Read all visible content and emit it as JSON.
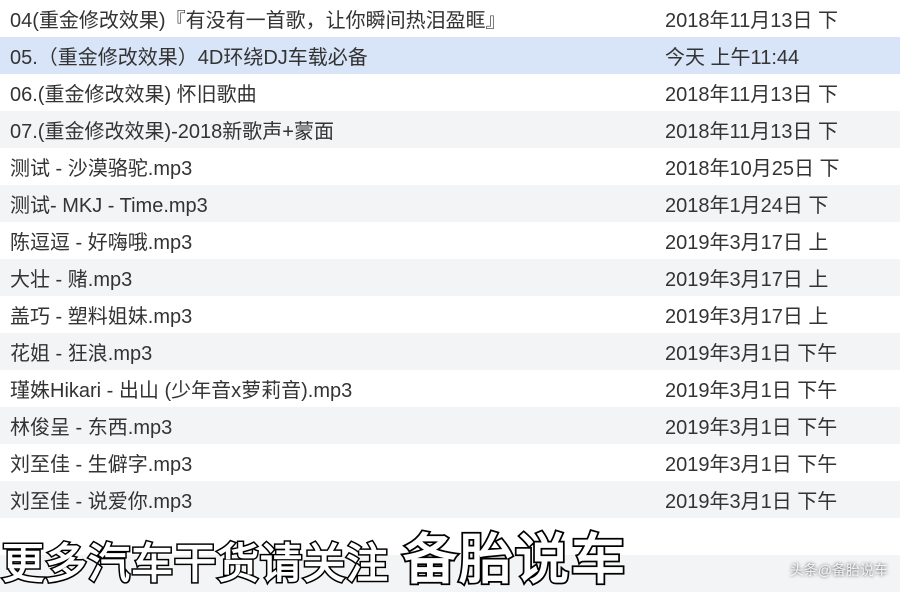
{
  "files": [
    {
      "name": "04(重金修改效果)『有没有一首歌，让你瞬间热泪盈眶』",
      "date": "2018年11月13日 下",
      "selected": false,
      "stripe": "odd"
    },
    {
      "name": "05.（重金修改效果）4D环绕DJ车载必备",
      "date": "今天 上午11:44",
      "selected": true,
      "stripe": "even"
    },
    {
      "name": "06.(重金修改效果) 怀旧歌曲",
      "date": "2018年11月13日 下",
      "selected": false,
      "stripe": "odd"
    },
    {
      "name": "07.(重金修改效果)-2018新歌声+蒙面",
      "date": "2018年11月13日 下",
      "selected": false,
      "stripe": "even"
    },
    {
      "name": "测试 - 沙漠骆驼.mp3",
      "date": "2018年10月25日 下",
      "selected": false,
      "stripe": "odd"
    },
    {
      "name": "测试- MKJ - Time.mp3",
      "date": "2018年1月24日 下",
      "selected": false,
      "stripe": "even"
    },
    {
      "name": "陈逗逗 - 好嗨哦.mp3",
      "date": "2019年3月17日 上",
      "selected": false,
      "stripe": "odd"
    },
    {
      "name": "大壮 - 赌.mp3",
      "date": "2019年3月17日 上",
      "selected": false,
      "stripe": "even"
    },
    {
      "name": "盖巧 - 塑料姐妹.mp3",
      "date": "2019年3月17日 上",
      "selected": false,
      "stripe": "odd"
    },
    {
      "name": "花姐 - 狂浪.mp3",
      "date": "2019年3月1日 下午",
      "selected": false,
      "stripe": "even"
    },
    {
      "name": "瑾姝Hikari - 出山 (少年音x萝莉音).mp3",
      "date": "2019年3月1日 下午",
      "selected": false,
      "stripe": "odd"
    },
    {
      "name": "林俊呈 - 东西.mp3",
      "date": "2019年3月1日 下午",
      "selected": false,
      "stripe": "even"
    },
    {
      "name": "刘至佳 - 生僻字.mp3",
      "date": "2019年3月1日 下午",
      "selected": false,
      "stripe": "odd"
    },
    {
      "name": "刘至佳 - 说爱你.mp3",
      "date": "2019年3月1日 下午",
      "selected": false,
      "stripe": "even"
    },
    {
      "name": "",
      "date": "",
      "selected": false,
      "stripe": "odd"
    },
    {
      "name": "",
      "date": "",
      "selected": false,
      "stripe": "even"
    }
  ],
  "overlay": {
    "main": "更多汽车干货请关注",
    "brand": "备胎说车"
  },
  "watermark": "头条@备胎说车"
}
